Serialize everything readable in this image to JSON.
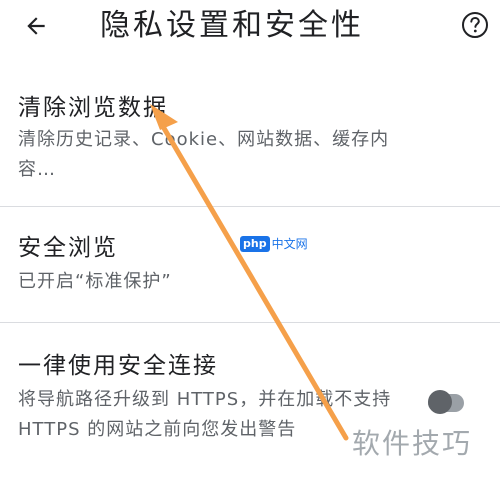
{
  "header": {
    "back_icon": "arrow-left-icon",
    "title": "隐私设置和安全性",
    "help_icon": "help-circle-icon"
  },
  "items": [
    {
      "title": "清除浏览数据",
      "description": "清除历史记录、Cookie、网站数据、缓存内容…"
    },
    {
      "title": "安全浏览",
      "description": "已开启“标准保护”"
    },
    {
      "title": "一律使用安全连接",
      "description": "将导航路径升级到 HTTPS，并在加载不支持 HTTPS 的网站之前向您发出警告",
      "toggle_on": false
    }
  ],
  "watermarks": {
    "php_badge": "php",
    "php_text": "中文网",
    "corner": "软件技巧"
  },
  "colors": {
    "annotation_arrow": "#f5a04a",
    "toggle_track": "#9aa0a6",
    "toggle_knob": "#5f6368",
    "divider": "#dadce0"
  }
}
